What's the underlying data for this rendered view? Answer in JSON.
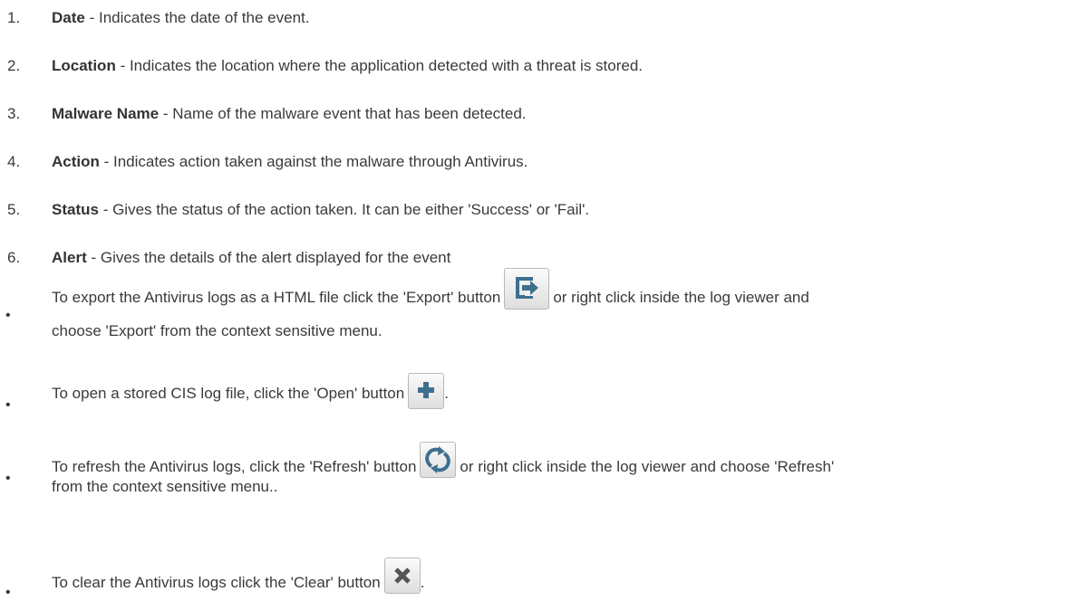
{
  "items": [
    {
      "num": "1.",
      "term": "Date",
      "desc": " - Indicates the date of the event."
    },
    {
      "num": "2.",
      "term": "Location",
      "desc": " - Indicates the location where the application detected with a threat is stored."
    },
    {
      "num": "3.",
      "term": "Malware Name",
      "desc": " - Name of the malware event that has been detected."
    },
    {
      "num": "4.",
      "term": "Action",
      "desc": " - Indicates action taken against the malware through Antivirus."
    },
    {
      "num": "5.",
      "term": "Status",
      "desc": " - Gives the status of the action taken. It can be either 'Success' or 'Fail'."
    },
    {
      "num": "6.",
      "term": "Alert",
      "desc": " - Gives the details of the alert displayed for the event"
    }
  ],
  "bullets": {
    "export": {
      "before": "To export the Antivirus logs as a HTML file click the 'Export' button",
      "after": "or right click inside the log viewer and",
      "line2": "choose 'Export' from the context sensitive menu.",
      "icon": "export-icon"
    },
    "open": {
      "before": "To open a stored CIS log file, click the 'Open' button",
      "after": ".",
      "icon": "plus-icon"
    },
    "refresh": {
      "before": "To refresh the Antivirus logs, click the 'Refresh' button",
      "after": "or right click inside the log viewer and choose 'Refresh'",
      "line2": "from the context sensitive menu..",
      "icon": "refresh-icon"
    },
    "clear": {
      "before": "To clear the Antivirus logs click the 'Clear' button",
      "after": ".",
      "icon": "close-icon"
    }
  },
  "bullet_char": "•",
  "colors": {
    "text": "#3a3a3a",
    "icon": "#3f6f8f",
    "close_icon": "#555555"
  }
}
